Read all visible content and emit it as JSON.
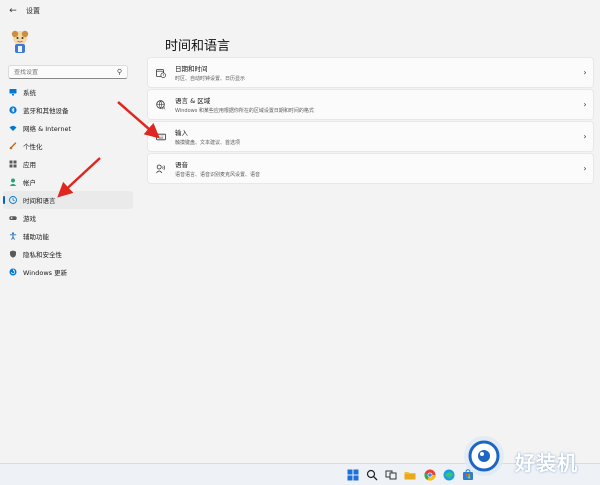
{
  "window": {
    "title": "设置",
    "back_icon": "back-arrow-icon"
  },
  "sidebar": {
    "search_placeholder": "查找设置",
    "items": [
      {
        "label": "系统",
        "icon": "monitor-icon",
        "color": "#0078d4"
      },
      {
        "label": "蓝牙和其他设备",
        "icon": "bluetooth-icon",
        "color": "#0078d4"
      },
      {
        "label": "网络 & Internet",
        "icon": "wifi-icon",
        "color": "#0078d4"
      },
      {
        "label": "个性化",
        "icon": "brush-icon",
        "color": "#c46a1b"
      },
      {
        "label": "应用",
        "icon": "apps-icon",
        "color": "#5a5a5a"
      },
      {
        "label": "帐户",
        "icon": "person-icon",
        "color": "#2aa37a"
      },
      {
        "label": "时间和语言",
        "icon": "globe-clock-icon",
        "color": "#0078d4",
        "active": true
      },
      {
        "label": "游戏",
        "icon": "gamepad-icon",
        "color": "#5a5a5a"
      },
      {
        "label": "辅助功能",
        "icon": "accessibility-icon",
        "color": "#1f70c1"
      },
      {
        "label": "隐私和安全性",
        "icon": "shield-icon",
        "color": "#5a5a5a"
      },
      {
        "label": "Windows 更新",
        "icon": "update-icon",
        "color": "#0078d4"
      }
    ]
  },
  "main": {
    "title": "时间和语言",
    "cards": [
      {
        "title": "日期和时间",
        "subtitle": "时区、自动时钟设置、日历显示",
        "icon": "calendar-clock-icon"
      },
      {
        "title": "语言 & 区域",
        "subtitle": "Windows 和某些应用根据你所在的区域设置日期和时间的格式",
        "icon": "language-icon"
      },
      {
        "title": "输入",
        "subtitle": "触摸键盘、文本建议、首选项",
        "icon": "keyboard-icon"
      },
      {
        "title": "语音",
        "subtitle": "语音语言、语音识别麦克风设置、语音",
        "icon": "microphone-icon"
      }
    ]
  },
  "watermark": {
    "text": "好装机"
  },
  "colors": {
    "accent": "#0067c0",
    "annotation": "#e0271f"
  }
}
